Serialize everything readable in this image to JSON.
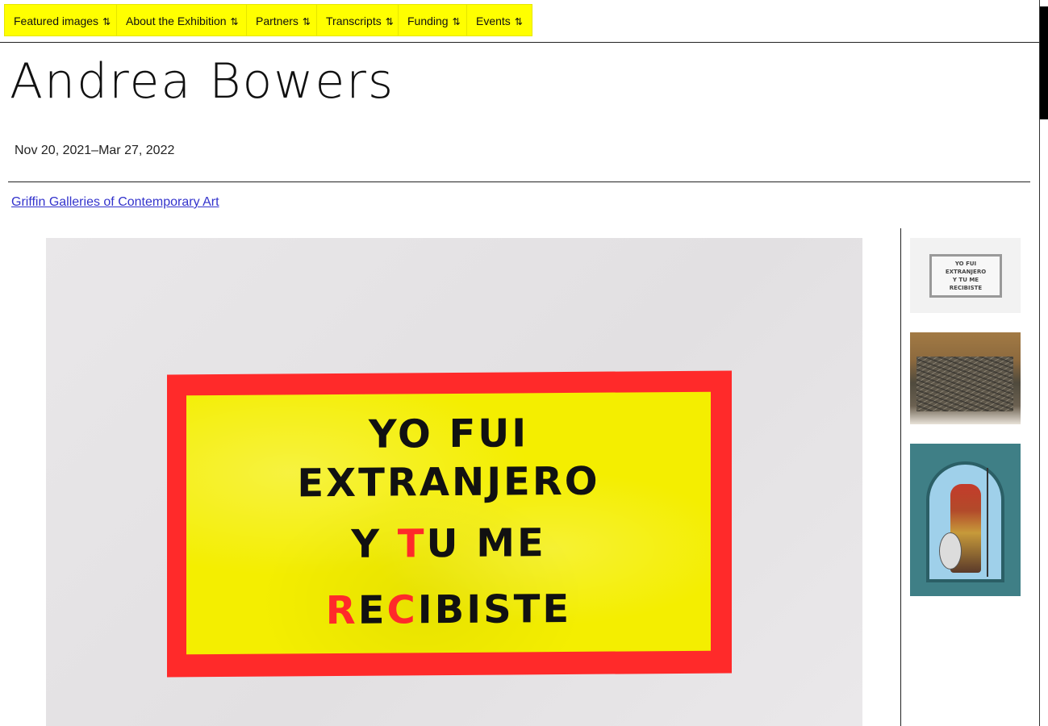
{
  "nav": {
    "items": [
      {
        "label": "Featured images",
        "icon": "sort-arrows-icon",
        "glyph": "⇅"
      },
      {
        "label": "About the Exhibition",
        "icon": "sort-arrows-icon",
        "glyph": "⇅"
      },
      {
        "label": "Partners",
        "icon": "sort-arrows-icon",
        "glyph": "⇅"
      },
      {
        "label": "Transcripts",
        "icon": "sort-arrows-icon",
        "glyph": "⇅"
      },
      {
        "label": "Funding",
        "icon": "sort-arrows-icon",
        "glyph": "⇅"
      },
      {
        "label": "Events",
        "icon": "sort-arrows-icon",
        "glyph": "⇅"
      }
    ],
    "accent_color": "#ffff00"
  },
  "exhibition": {
    "title": "Andrea Bowers",
    "dates": "Nov 20, 2021–Mar 27, 2022",
    "venue": "Griffin Galleries of Contemporary Art"
  },
  "main_image": {
    "banner_lines": [
      "YO FUI",
      "EXTRANJERO",
      "Y TU ME",
      "RECIBISTE"
    ],
    "banner_colors": {
      "border": "#ff2a2a",
      "field": "#f4ee00",
      "text": "#111111"
    }
  },
  "thumbnails": [
    {
      "text_lines": [
        "YO  FUI",
        "EXTRANJERO",
        "Y TU ME",
        "RECIBISTE"
      ]
    },
    {},
    {}
  ]
}
